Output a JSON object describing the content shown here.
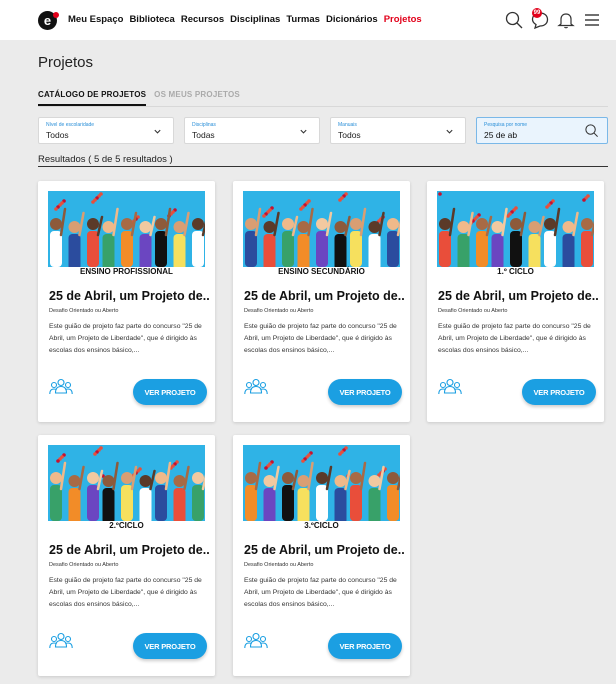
{
  "nav": {
    "logo": "e",
    "items": [
      "Meu Espaço",
      "Biblioteca",
      "Recursos",
      "Disciplinas",
      "Turmas",
      "Dicionários",
      "Projetos"
    ],
    "active_index": 6,
    "notification_count": "99",
    "icons": [
      "search-icon",
      "chat-icon",
      "bell-icon",
      "menu-icon"
    ]
  },
  "page": {
    "title": "Projetos",
    "tabs": [
      "CATÁLOGO DE PROJETOS",
      "OS MEUS PROJETOS"
    ],
    "active_tab": 0
  },
  "filters": [
    {
      "label": "Nível de escolaridade",
      "value": "Todos"
    },
    {
      "label": "Disciplinas",
      "value": "Todas"
    },
    {
      "label": "Manuais",
      "value": "Todos"
    }
  ],
  "search": {
    "label": "Pesquisa por nome",
    "value": "25 de ab"
  },
  "results_text": "Resultados ( 5 de 5 resultados )",
  "cards": [
    {
      "level": "ENSINO PROFISSIONAL",
      "title": "25 de Abril, um Projeto de...",
      "type": "Desafio Orientado ou Aberto",
      "desc": "Este guião de projeto faz parte do concurso \"25 de Abril, um Projeto de Liberdade\", que é dirigido às escolas dos ensinos básico,...",
      "button": "VER PROJETO"
    },
    {
      "level": "ENSINO SECUNDÁRIO",
      "title": "25 de Abril, um Projeto de...",
      "type": "Desafio Orientado ou Aberto",
      "desc": "Este guião de projeto faz parte do concurso \"25 de Abril, um Projeto de Liberdade\", que é dirigido às escolas dos ensinos básico,...",
      "button": "VER PROJETO"
    },
    {
      "level": "1.º CICLO",
      "title": "25 de Abril, um Projeto de...",
      "type": "Desafio Orientado ou Aberto",
      "desc": "Este guião de projeto faz parte do concurso \"25 de Abril, um Projeto de Liberdade\", que é dirigido às escolas dos ensinos básico,...",
      "button": "VER PROJETO"
    },
    {
      "level": "2.ºCICLO",
      "title": "25 de Abril, um Projeto de...",
      "type": "Desafio Orientado ou Aberto",
      "desc": "Este guião de projeto faz parte do concurso \"25 de Abril, um Projeto de Liberdade\", que é dirigido às escolas dos ensinos básico,...",
      "button": "VER PROJETO"
    },
    {
      "level": "3.ºCICLO",
      "title": "25 de Abril, um Projeto de...",
      "type": "Desafio Orientado ou Aberto",
      "desc": "Este guião de projeto faz parte do concurso \"25 de Abril, um Projeto de Liberdade\", que é dirigido às escolas dos ensinos básico,...",
      "button": "VER PROJETO"
    }
  ],
  "colors": {
    "accent": "#1b9fe2",
    "active_nav": "#e2001a",
    "banner": "#2fb3e6"
  }
}
